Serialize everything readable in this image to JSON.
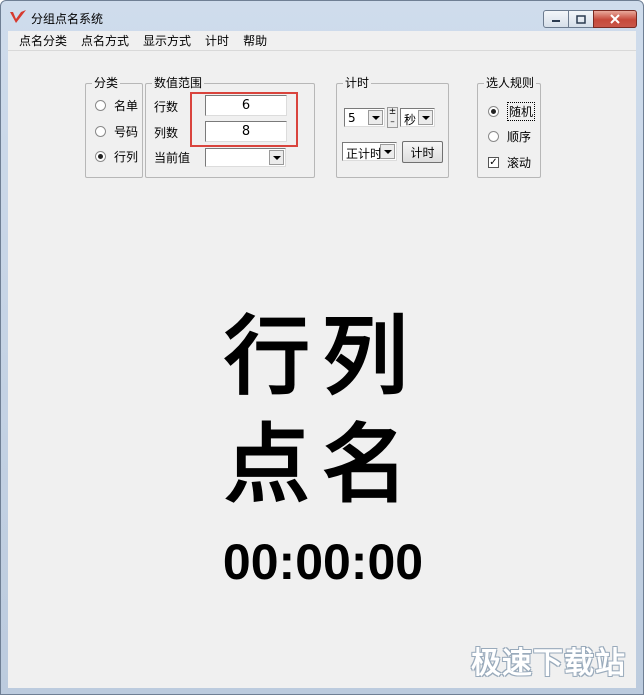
{
  "window": {
    "title": "分组点名系统"
  },
  "menu": [
    "点名分类",
    "点名方式",
    "显示方式",
    "计时",
    "帮助"
  ],
  "category": {
    "legend": "分类",
    "options": [
      {
        "label": "名单",
        "selected": false
      },
      {
        "label": "号码",
        "selected": false
      },
      {
        "label": "行列",
        "selected": true
      }
    ]
  },
  "range": {
    "legend": "数值范围",
    "rows_label": "行数",
    "rows_value": "6",
    "cols_label": "列数",
    "cols_value": "8",
    "current_label": "当前值",
    "current_value": ""
  },
  "timing": {
    "legend": "计时",
    "amount": "5",
    "unit": "秒",
    "mode": "正计时",
    "button_label": "计时"
  },
  "rules": {
    "legend": "选人规则",
    "options": [
      {
        "label": "随机",
        "selected": true
      },
      {
        "label": "顺序",
        "selected": false
      }
    ],
    "scroll_label": "滚动",
    "scroll_checked": true
  },
  "display": {
    "line1": "行列",
    "line2": "点名",
    "timer": "00:00:00"
  },
  "watermark": "极速下载站",
  "colors": {
    "highlight": "#d9443d",
    "logo": "#d63a2f"
  }
}
